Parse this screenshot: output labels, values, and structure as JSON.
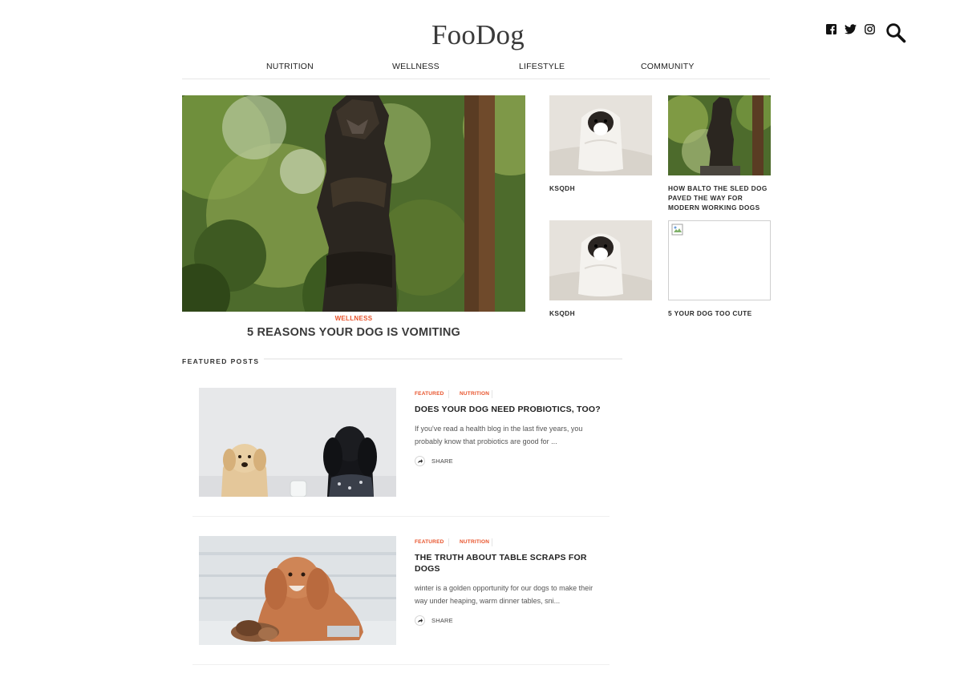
{
  "site": {
    "title": "FooDog"
  },
  "social": [
    "facebook-icon",
    "twitter-icon",
    "instagram-icon"
  ],
  "nav": {
    "items": [
      "NUTRITION",
      "WELLNESS",
      "LIFESTYLE",
      "COMMUNITY"
    ]
  },
  "hero": {
    "category": "WELLNESS",
    "title": "5 REASONS YOUR DOG IS VOMITING"
  },
  "thumbs": [
    {
      "title": "KSQDH"
    },
    {
      "title": "HOW BALTO THE SLED DOG PAVED THE WAY FOR MODERN WORKING DOGS"
    },
    {
      "title": "KSQDH"
    },
    {
      "title": "5 YOUR DOG TOO CUTE"
    }
  ],
  "featured": {
    "heading": "FEATURED POSTS",
    "posts": [
      {
        "categories": [
          "FEATURED",
          "NUTRITION"
        ],
        "title": "DOES YOUR DOG NEED PROBIOTICS, TOO?",
        "excerpt": "If you've read a health blog in the last five years, you probably know that probiotics are good for ...",
        "share": "SHARE"
      },
      {
        "categories": [
          "FEATURED",
          "NUTRITION"
        ],
        "title": "THE TRUTH ABOUT TABLE SCRAPS FOR DOGS",
        "excerpt": "winter is a golden opportunity for our dogs to make their way under heaping, warm dinner tables, sni...",
        "share": "SHARE"
      }
    ]
  },
  "colors": {
    "accent": "#e8532b",
    "text": "#222222"
  }
}
